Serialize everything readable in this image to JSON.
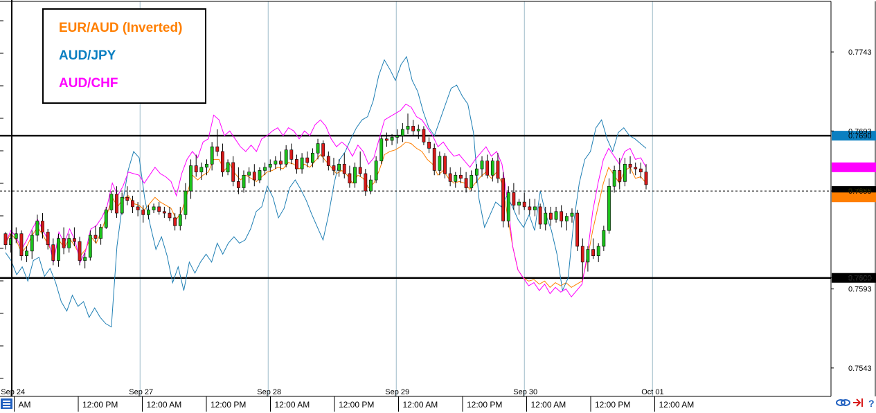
{
  "chart_data": {
    "type": "line",
    "title": "",
    "ylim": [
      0.7525,
      0.7775
    ],
    "xlim": [
      0,
      100
    ],
    "y_ticks": [
      0.7543,
      0.7593,
      0.76,
      0.7655,
      0.769,
      0.7693,
      0.7743
    ],
    "y_ticks_shown": [
      "0.7743",
      "0.7693",
      "0.7655",
      "0.7600",
      "0.7593",
      "0.7543"
    ],
    "x_ticks": [
      {
        "x": 2,
        "label": "AM"
      },
      {
        "x": 12,
        "label": "12:00 PM"
      },
      {
        "x": 22,
        "label": "12:00 AM"
      },
      {
        "x": 32,
        "label": "12:00 PM"
      },
      {
        "x": 42,
        "label": "12:00 AM"
      },
      {
        "x": 52,
        "label": "12:00 PM"
      },
      {
        "x": 62,
        "label": "12:00 AM"
      },
      {
        "x": 72,
        "label": "12:00 PM"
      },
      {
        "x": 82,
        "label": "12:00 AM"
      },
      {
        "x": 92,
        "label": "12:00 PM"
      },
      {
        "x": 102,
        "label": "12:00 AM"
      }
    ],
    "date_labels": [
      {
        "x": 1,
        "label": "Sep 24"
      },
      {
        "x": 21,
        "label": "Sep 27"
      },
      {
        "x": 41,
        "label": "Sep 28"
      },
      {
        "x": 61,
        "label": "Sep 29"
      },
      {
        "x": 81,
        "label": "Sep 30"
      },
      {
        "x": 101,
        "label": "Oct 01"
      }
    ],
    "horizontal_levels": [
      0.769,
      0.76
    ],
    "dotted_level": 0.7655,
    "price_tags": [
      {
        "label": "0.7690",
        "value": 0.769,
        "color": "#0b7fc1",
        "text_color": "#000000"
      },
      {
        "label": "",
        "value": 0.767,
        "color": "#ff00ff",
        "text_color": "#000000"
      },
      {
        "label": "0.7655",
        "value": 0.7655,
        "color": "#000000",
        "text_color": "#ffff00"
      },
      {
        "label": "",
        "value": 0.7651,
        "color": "#ff7f00",
        "text_color": "#000000"
      },
      {
        "label": "0.7600",
        "value": 0.76,
        "color": "#000000",
        "text_color": "#ffffff"
      }
    ],
    "candles": [
      [
        0.7628,
        0.7629,
        0.7618,
        0.7621
      ],
      [
        0.7621,
        0.7628,
        0.7616,
        0.7625
      ],
      [
        0.7625,
        0.7632,
        0.7622,
        0.7628
      ],
      [
        0.7628,
        0.763,
        0.7611,
        0.7614
      ],
      [
        0.7614,
        0.762,
        0.761,
        0.7617
      ],
      [
        0.7617,
        0.763,
        0.7612,
        0.7627
      ],
      [
        0.7627,
        0.764,
        0.7623,
        0.7636
      ],
      [
        0.7636,
        0.7641,
        0.7625,
        0.7629
      ],
      [
        0.7629,
        0.7631,
        0.7618,
        0.7621
      ],
      [
        0.7621,
        0.7625,
        0.7608,
        0.7611
      ],
      [
        0.7611,
        0.7628,
        0.7607,
        0.7625
      ],
      [
        0.7625,
        0.7632,
        0.7615,
        0.7619
      ],
      [
        0.7619,
        0.7628,
        0.7616,
        0.7625
      ],
      [
        0.7625,
        0.7632,
        0.762,
        0.7623
      ],
      [
        0.7623,
        0.7626,
        0.7608,
        0.7611
      ],
      [
        0.7611,
        0.7616,
        0.7606,
        0.7613
      ],
      [
        0.7613,
        0.763,
        0.7611,
        0.7627
      ],
      [
        0.7627,
        0.7633,
        0.7622,
        0.7625
      ],
      [
        0.7625,
        0.7634,
        0.7621,
        0.7632
      ],
      [
        0.7632,
        0.7645,
        0.7631,
        0.7643
      ],
      [
        0.7643,
        0.7655,
        0.7641,
        0.7653
      ],
      [
        0.7653,
        0.7658,
        0.7638,
        0.7641
      ],
      [
        0.7641,
        0.7654,
        0.764,
        0.7651
      ],
      [
        0.7651,
        0.7658,
        0.7646,
        0.7649
      ],
      [
        0.7649,
        0.7652,
        0.7641,
        0.7645
      ],
      [
        0.7645,
        0.7648,
        0.7639,
        0.7643
      ],
      [
        0.7643,
        0.7646,
        0.7635,
        0.764
      ],
      [
        0.764,
        0.7646,
        0.7637,
        0.7643
      ],
      [
        0.7643,
        0.7647,
        0.7641,
        0.7645
      ],
      [
        0.7645,
        0.7648,
        0.764,
        0.7642
      ],
      [
        0.7642,
        0.7645,
        0.7638,
        0.7641
      ],
      [
        0.7641,
        0.7645,
        0.7636,
        0.7638
      ],
      [
        0.7638,
        0.7641,
        0.763,
        0.7633
      ],
      [
        0.7633,
        0.7645,
        0.763,
        0.764
      ],
      [
        0.764,
        0.766,
        0.7637,
        0.7655
      ],
      [
        0.7655,
        0.7675,
        0.765,
        0.7671
      ],
      [
        0.7671,
        0.7678,
        0.7664,
        0.7667
      ],
      [
        0.7667,
        0.7673,
        0.7662,
        0.767
      ],
      [
        0.767,
        0.7675,
        0.7665,
        0.7672
      ],
      [
        0.7672,
        0.7686,
        0.7668,
        0.7683
      ],
      [
        0.7683,
        0.7694,
        0.7677,
        0.768
      ],
      [
        0.768,
        0.7685,
        0.7664,
        0.7667
      ],
      [
        0.7667,
        0.7675,
        0.7665,
        0.7673
      ],
      [
        0.7673,
        0.7677,
        0.7658,
        0.7661
      ],
      [
        0.7661,
        0.767,
        0.7653,
        0.7657
      ],
      [
        0.7657,
        0.7668,
        0.7654,
        0.7665
      ],
      [
        0.7665,
        0.767,
        0.766,
        0.7667
      ],
      [
        0.7667,
        0.7672,
        0.7658,
        0.7662
      ],
      [
        0.7662,
        0.767,
        0.766,
        0.7668
      ],
      [
        0.7668,
        0.7673,
        0.7665,
        0.767
      ],
      [
        0.767,
        0.7675,
        0.7667,
        0.7672
      ],
      [
        0.7672,
        0.7677,
        0.7669,
        0.7674
      ],
      [
        0.7674,
        0.768,
        0.7668,
        0.7672
      ],
      [
        0.7672,
        0.7684,
        0.767,
        0.7681
      ],
      [
        0.7681,
        0.7685,
        0.7672,
        0.7675
      ],
      [
        0.7675,
        0.7678,
        0.7666,
        0.7669
      ],
      [
        0.7669,
        0.7679,
        0.7666,
        0.7676
      ],
      [
        0.7676,
        0.768,
        0.767,
        0.7673
      ],
      [
        0.7673,
        0.7682,
        0.767,
        0.7679
      ],
      [
        0.7679,
        0.7688,
        0.7675,
        0.7685
      ],
      [
        0.7685,
        0.7687,
        0.7673,
        0.7677
      ],
      [
        0.7677,
        0.768,
        0.7668,
        0.7671
      ],
      [
        0.7671,
        0.7676,
        0.7665,
        0.7668
      ],
      [
        0.7668,
        0.7675,
        0.7664,
        0.7672
      ],
      [
        0.7672,
        0.7679,
        0.7663,
        0.7666
      ],
      [
        0.7666,
        0.7671,
        0.7657,
        0.766
      ],
      [
        0.766,
        0.7673,
        0.7657,
        0.767
      ],
      [
        0.767,
        0.768,
        0.7664,
        0.7666
      ],
      [
        0.7666,
        0.7669,
        0.7652,
        0.7655
      ],
      [
        0.7655,
        0.7665,
        0.7653,
        0.7662
      ],
      [
        0.7662,
        0.7677,
        0.766,
        0.7674
      ],
      [
        0.7674,
        0.769,
        0.7672,
        0.7688
      ],
      [
        0.7688,
        0.7692,
        0.7683,
        0.7687
      ],
      [
        0.7687,
        0.7691,
        0.7684,
        0.7689
      ],
      [
        0.7689,
        0.7694,
        0.7685,
        0.769
      ],
      [
        0.769,
        0.7698,
        0.7686,
        0.7694
      ],
      [
        0.7694,
        0.7704,
        0.7691,
        0.7696
      ],
      [
        0.7696,
        0.77,
        0.769,
        0.7693
      ],
      [
        0.7693,
        0.7697,
        0.7688,
        0.7694
      ],
      [
        0.7694,
        0.7696,
        0.7684,
        0.7686
      ],
      [
        0.7686,
        0.7689,
        0.7679,
        0.7682
      ],
      [
        0.7682,
        0.7685,
        0.7665,
        0.7668
      ],
      [
        0.7668,
        0.768,
        0.7665,
        0.7677
      ],
      [
        0.7677,
        0.7679,
        0.7663,
        0.7666
      ],
      [
        0.7666,
        0.767,
        0.7658,
        0.7661
      ],
      [
        0.7661,
        0.7667,
        0.7657,
        0.7665
      ],
      [
        0.7665,
        0.767,
        0.766,
        0.7663
      ],
      [
        0.7663,
        0.7667,
        0.7654,
        0.7657
      ],
      [
        0.7657,
        0.7668,
        0.7655,
        0.7665
      ],
      [
        0.7665,
        0.7672,
        0.766,
        0.7669
      ],
      [
        0.7669,
        0.7677,
        0.7664,
        0.7674
      ],
      [
        0.7674,
        0.7678,
        0.7663,
        0.7665
      ],
      [
        0.7665,
        0.7676,
        0.7661,
        0.7674
      ],
      [
        0.7674,
        0.7679,
        0.766,
        0.7663
      ],
      [
        0.7663,
        0.7667,
        0.7632,
        0.7636
      ],
      [
        0.7636,
        0.7658,
        0.7632,
        0.7654
      ],
      [
        0.7654,
        0.766,
        0.7643,
        0.7646
      ],
      [
        0.7646,
        0.765,
        0.764,
        0.7648
      ],
      [
        0.7648,
        0.7654,
        0.7643,
        0.7645
      ],
      [
        0.7645,
        0.765,
        0.764,
        0.7643
      ],
      [
        0.7643,
        0.765,
        0.7639,
        0.7645
      ],
      [
        0.7645,
        0.7647,
        0.7631,
        0.7634
      ],
      [
        0.7634,
        0.7645,
        0.763,
        0.7641
      ],
      [
        0.7641,
        0.7645,
        0.7633,
        0.7637
      ],
      [
        0.7637,
        0.7645,
        0.7635,
        0.7642
      ],
      [
        0.7642,
        0.7646,
        0.7632,
        0.7636
      ],
      [
        0.7636,
        0.7641,
        0.763,
        0.7639
      ],
      [
        0.7639,
        0.7644,
        0.7635,
        0.7641
      ],
      [
        0.7641,
        0.7643,
        0.7617,
        0.762
      ],
      [
        0.762,
        0.7625,
        0.7599,
        0.761
      ],
      [
        0.761,
        0.762,
        0.7604,
        0.7618
      ],
      [
        0.7618,
        0.7625,
        0.7612,
        0.7614
      ],
      [
        0.7614,
        0.7622,
        0.761,
        0.762
      ],
      [
        0.762,
        0.7633,
        0.7617,
        0.763
      ],
      [
        0.763,
        0.7663,
        0.7628,
        0.7658
      ],
      [
        0.7658,
        0.7671,
        0.7654,
        0.7668
      ],
      [
        0.7668,
        0.7676,
        0.7656,
        0.7661
      ],
      [
        0.7661,
        0.7676,
        0.7658,
        0.7672
      ],
      [
        0.7672,
        0.7677,
        0.7666,
        0.767
      ],
      [
        0.767,
        0.7673,
        0.7665,
        0.7669
      ],
      [
        0.7669,
        0.7673,
        0.7663,
        0.7667
      ],
      [
        0.7667,
        0.7672,
        0.7656,
        0.7659
      ]
    ],
    "series": [
      {
        "name": "EUR/AUD (Inverted)",
        "color": "#ff7f00",
        "values": [
          0.7622,
          0.7628,
          0.7624,
          0.7616,
          0.762,
          0.7627,
          0.7632,
          0.7627,
          0.7621,
          0.7614,
          0.7624,
          0.7619,
          0.7625,
          0.762,
          0.7614,
          0.7618,
          0.7626,
          0.7622,
          0.763,
          0.764,
          0.7651,
          0.7645,
          0.765,
          0.7652,
          0.7647,
          0.7646,
          0.7643,
          0.7647,
          0.7651,
          0.7648,
          0.7646,
          0.7644,
          0.7637,
          0.7642,
          0.7653,
          0.7665,
          0.7662,
          0.7665,
          0.7667,
          0.7675,
          0.7675,
          0.7668,
          0.7672,
          0.7666,
          0.7662,
          0.7665,
          0.7663,
          0.7661,
          0.7664,
          0.7667,
          0.7668,
          0.767,
          0.7669,
          0.7673,
          0.7672,
          0.7669,
          0.7672,
          0.767,
          0.7674,
          0.7678,
          0.7674,
          0.767,
          0.7666,
          0.7668,
          0.7665,
          0.766,
          0.7665,
          0.7663,
          0.7657,
          0.766,
          0.7668,
          0.7678,
          0.768,
          0.7681,
          0.7683,
          0.7686,
          0.7685,
          0.7682,
          0.768,
          0.7675,
          0.7672,
          0.7665,
          0.7668,
          0.7663,
          0.766,
          0.7661,
          0.766,
          0.7656,
          0.766,
          0.7664,
          0.7667,
          0.7663,
          0.7667,
          0.766,
          0.764,
          0.762,
          0.7605,
          0.76,
          0.7598,
          0.7599,
          0.7596,
          0.7598,
          0.7594,
          0.7597,
          0.7595,
          0.7597,
          0.7594,
          0.7596,
          0.7598,
          0.7612,
          0.763,
          0.7645,
          0.766,
          0.767,
          0.7665,
          0.766,
          0.7668,
          0.767,
          0.7663,
          0.7664,
          0.766
        ]
      },
      {
        "name": "AUD/JPY",
        "color": "#1f7fb4",
        "values": [
          0.7616,
          0.7611,
          0.7602,
          0.7607,
          0.7598,
          0.7611,
          0.7613,
          0.7601,
          0.7606,
          0.7597,
          0.7585,
          0.7579,
          0.7589,
          0.7582,
          0.7585,
          0.7575,
          0.7581,
          0.7575,
          0.7571,
          0.7569,
          0.762,
          0.7647,
          0.7668,
          0.768,
          0.7676,
          0.765,
          0.7633,
          0.7618,
          0.7626,
          0.7614,
          0.7597,
          0.7607,
          0.7592,
          0.761,
          0.7603,
          0.761,
          0.7615,
          0.761,
          0.7622,
          0.7615,
          0.7622,
          0.7626,
          0.7622,
          0.7624,
          0.7631,
          0.7642,
          0.7645,
          0.7658,
          0.7651,
          0.7638,
          0.7644,
          0.7657,
          0.7662,
          0.7656,
          0.7649,
          0.764,
          0.7632,
          0.7624,
          0.764,
          0.766,
          0.7675,
          0.768,
          0.7688,
          0.7695,
          0.77,
          0.7702,
          0.7712,
          0.7728,
          0.7738,
          0.7732,
          0.7725,
          0.7735,
          0.774,
          0.7725,
          0.7718,
          0.7705,
          0.7695,
          0.769,
          0.77,
          0.771,
          0.772,
          0.7722,
          0.7715,
          0.771,
          0.7692,
          0.765,
          0.7632,
          0.764,
          0.7648,
          0.7645,
          0.7652,
          0.7645,
          0.7637,
          0.7632,
          0.764,
          0.763,
          0.7655,
          0.764,
          0.763,
          0.7615,
          0.7592,
          0.76,
          0.7635,
          0.766,
          0.7675,
          0.768,
          0.7695,
          0.77,
          0.7688,
          0.768,
          0.7692,
          0.7695,
          0.769,
          0.7688,
          0.7685,
          0.7682
        ]
      },
      {
        "name": "AUD/CHF",
        "color": "#ff00ff",
        "values": [
          0.7622,
          0.763,
          0.7626,
          0.7618,
          0.7624,
          0.7631,
          0.7637,
          0.763,
          0.7624,
          0.761,
          0.7629,
          0.7622,
          0.7631,
          0.7624,
          0.761,
          0.7617,
          0.7631,
          0.7633,
          0.7638,
          0.7645,
          0.766,
          0.7652,
          0.7658,
          0.7667,
          0.7666,
          0.7665,
          0.766,
          0.7665,
          0.767,
          0.7666,
          0.7664,
          0.7661,
          0.7652,
          0.7666,
          0.7675,
          0.768,
          0.7676,
          0.7686,
          0.7688,
          0.7703,
          0.77,
          0.769,
          0.7693,
          0.7688,
          0.7683,
          0.768,
          0.7684,
          0.768,
          0.7688,
          0.769,
          0.7693,
          0.7695,
          0.769,
          0.7695,
          0.7693,
          0.7688,
          0.7693,
          0.769,
          0.7697,
          0.77,
          0.7696,
          0.7688,
          0.7683,
          0.7686,
          0.7683,
          0.7677,
          0.7684,
          0.768,
          0.7672,
          0.7676,
          0.7688,
          0.77,
          0.7702,
          0.7704,
          0.7706,
          0.771,
          0.7708,
          0.7702,
          0.77,
          0.7695,
          0.769,
          0.7683,
          0.7686,
          0.7681,
          0.7677,
          0.7678,
          0.7674,
          0.767,
          0.7675,
          0.7679,
          0.7683,
          0.7677,
          0.768,
          0.7672,
          0.765,
          0.762,
          0.7605,
          0.76,
          0.7595,
          0.7597,
          0.7592,
          0.7596,
          0.759,
          0.7594,
          0.7591,
          0.7593,
          0.7588,
          0.7592,
          0.7596,
          0.7615,
          0.7642,
          0.766,
          0.7675,
          0.7682,
          0.7677,
          0.7672,
          0.768,
          0.7682,
          0.7675,
          0.7676,
          0.767
        ]
      }
    ]
  },
  "legend": {
    "items": [
      {
        "label": "EUR/AUD (Inverted)",
        "color": "#ff7f00"
      },
      {
        "label": "AUD/JPY",
        "color": "#0b7fc1"
      },
      {
        "label": "AUD/CHF",
        "color": "#ff00ff"
      }
    ]
  },
  "colors": {
    "bull_candle": "#1bc21b",
    "bear_candle": "#d81a1a",
    "grid_vertical": "#9dbbc9",
    "level_line": "#000000"
  },
  "bottom_icons": [
    "chain-link-icon",
    "arrow-to-line-icon",
    "help-icon"
  ],
  "menu_icon": "menu-list-icon",
  "help_glyph": "?"
}
